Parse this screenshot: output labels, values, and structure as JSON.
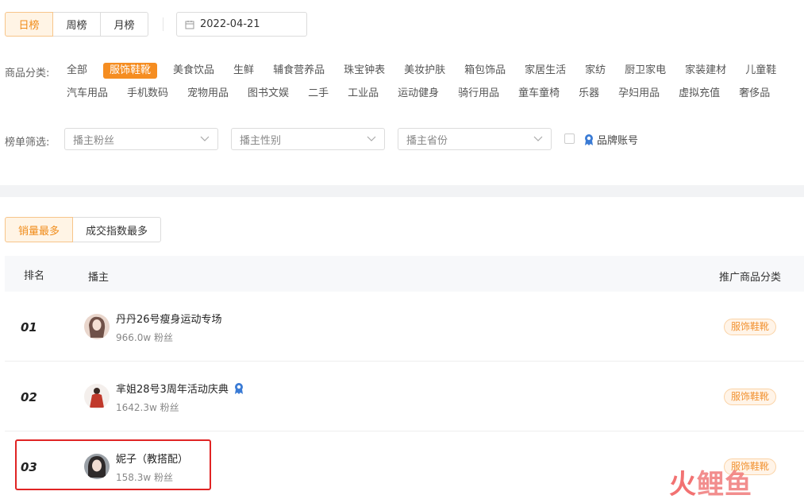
{
  "period_tabs": [
    {
      "label": "日榜",
      "active": true
    },
    {
      "label": "周榜",
      "active": false
    },
    {
      "label": "月榜",
      "active": false
    }
  ],
  "date": "2022-04-21",
  "category": {
    "label": "商品分类:",
    "row1": [
      "全部",
      "服饰鞋靴",
      "美食饮品",
      "生鲜",
      "辅食营养品",
      "珠宝钟表",
      "美妆护肤",
      "箱包饰品",
      "家居生活",
      "家纺",
      "厨卫家电",
      "家装建材",
      "儿童鞋"
    ],
    "row2": [
      "汽车用品",
      "手机数码",
      "宠物用品",
      "图书文娱",
      "二手",
      "工业品",
      "运动健身",
      "骑行用品",
      "童车童椅",
      "乐器",
      "孕妇用品",
      "虚拟充值",
      "奢侈品"
    ],
    "active": "服饰鞋靴"
  },
  "filter": {
    "label": "榜单筛选:",
    "fans_placeholder": "播主粉丝",
    "gender_placeholder": "播主性别",
    "province_placeholder": "播主省份",
    "brand_label": "品牌账号"
  },
  "sort_tabs": [
    {
      "label": "销量最多",
      "active": true
    },
    {
      "label": "成交指数最多",
      "active": false
    }
  ],
  "table": {
    "headers": {
      "rank": "排名",
      "host": "播主",
      "category": "推广商品分类"
    },
    "rows": [
      {
        "rank": "01",
        "name": "丹丹26号瘦身运动专场",
        "fans": "966.0w 粉丝",
        "category": "服饰鞋靴",
        "brand": false,
        "avatar_color": "#8a5a4a"
      },
      {
        "rank": "02",
        "name": "芈姐28号3周年活动庆典",
        "fans": "1642.3w 粉丝",
        "category": "服饰鞋靴",
        "brand": true,
        "avatar_color": "#c0392b"
      },
      {
        "rank": "03",
        "name": "妮子（教搭配）",
        "fans": "158.3w 粉丝",
        "category": "服饰鞋靴",
        "brand": false,
        "avatar_color": "#4a4a52"
      }
    ]
  },
  "watermark": {
    "part1": "火",
    "part2": "鲤鱼"
  },
  "colors": {
    "accent": "#f58d21",
    "highlight": "#e02424",
    "brand_icon": "#3a7bd5"
  }
}
